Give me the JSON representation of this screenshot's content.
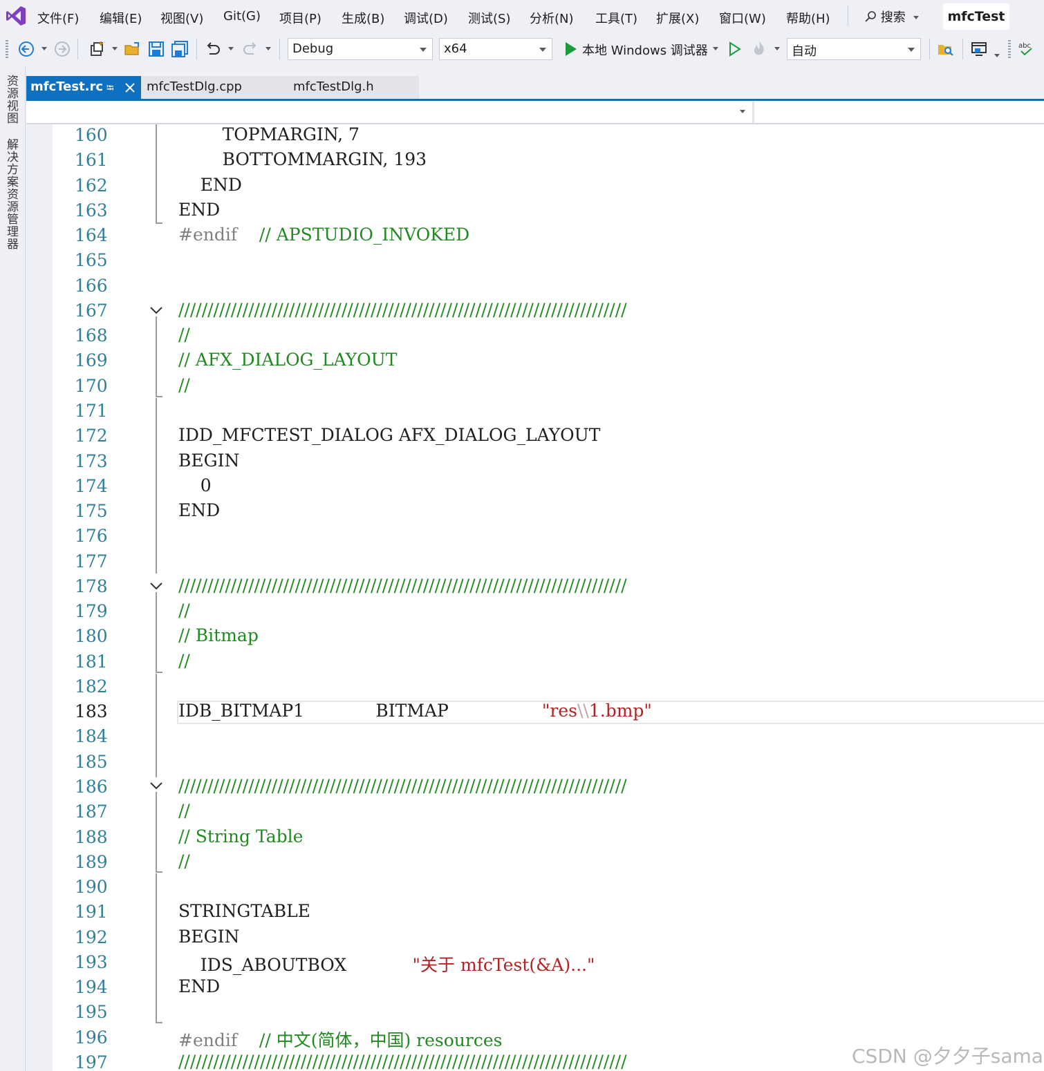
{
  "menubar": {
    "items": [
      "文件(F)",
      "编辑(E)",
      "视图(V)",
      "Git(G)",
      "项目(P)",
      "生成(B)",
      "调试(D)",
      "测试(S)",
      "分析(N)",
      "工具(T)",
      "扩展(X)",
      "窗口(W)",
      "帮助(H)"
    ],
    "search_label": "搜索",
    "solution_title": "mfcTest"
  },
  "toolbar": {
    "config_value": "Debug",
    "platform_value": "x64",
    "run_label": "本地 Windows 调试器",
    "auto_value": "自动"
  },
  "sidepanel": {
    "tabs": [
      "资源视图",
      "解决方案资源管理器"
    ]
  },
  "tabs": [
    {
      "label": "mfcTest.rc",
      "active": true
    },
    {
      "label": "mfcTestDlg.cpp",
      "active": false
    },
    {
      "label": "mfcTestDlg.h",
      "active": false
    }
  ],
  "editor": {
    "current_line": 183,
    "lines": [
      {
        "n": "160",
        "text": "        TOPMARGIN, 7",
        "kind": "plain"
      },
      {
        "n": "161",
        "text": "        BOTTOMMARGIN, 193",
        "kind": "plain"
      },
      {
        "n": "162",
        "text": "    END",
        "kind": "plain"
      },
      {
        "n": "163",
        "text": "END",
        "kind": "plain"
      },
      {
        "n": "164",
        "text": "#endif",
        "kind": "pp",
        "extra": "    // APSTUDIO_INVOKED"
      },
      {
        "n": "165",
        "text": "",
        "kind": "plain"
      },
      {
        "n": "166",
        "text": "",
        "kind": "plain"
      },
      {
        "n": "167",
        "text": "/////////////////////////////////////////////////////////////////////////////",
        "kind": "cm"
      },
      {
        "n": "168",
        "text": "//",
        "kind": "cm"
      },
      {
        "n": "169",
        "text": "// AFX_DIALOG_LAYOUT",
        "kind": "cm"
      },
      {
        "n": "170",
        "text": "//",
        "kind": "cm"
      },
      {
        "n": "171",
        "text": "",
        "kind": "plain"
      },
      {
        "n": "172",
        "text": "IDD_MFCTEST_DIALOG AFX_DIALOG_LAYOUT",
        "kind": "plain"
      },
      {
        "n": "173",
        "text": "BEGIN",
        "kind": "plain"
      },
      {
        "n": "174",
        "text": "    0",
        "kind": "plain"
      },
      {
        "n": "175",
        "text": "END",
        "kind": "plain"
      },
      {
        "n": "176",
        "text": "",
        "kind": "plain"
      },
      {
        "n": "177",
        "text": "",
        "kind": "plain"
      },
      {
        "n": "178",
        "text": "/////////////////////////////////////////////////////////////////////////////",
        "kind": "cm"
      },
      {
        "n": "179",
        "text": "//",
        "kind": "cm"
      },
      {
        "n": "180",
        "text": "// Bitmap",
        "kind": "cm"
      },
      {
        "n": "181",
        "text": "//",
        "kind": "cm"
      },
      {
        "n": "182",
        "text": "",
        "kind": "plain"
      },
      {
        "n": "183",
        "text": "IDB_BITMAP1             BITMAP                 ",
        "kind": "plain",
        "str_a": "\"res",
        "str_esc": "\\\\",
        "str_b": "1.bmp\""
      },
      {
        "n": "184",
        "text": "",
        "kind": "plain"
      },
      {
        "n": "185",
        "text": "",
        "kind": "plain"
      },
      {
        "n": "186",
        "text": "/////////////////////////////////////////////////////////////////////////////",
        "kind": "cm"
      },
      {
        "n": "187",
        "text": "//",
        "kind": "cm"
      },
      {
        "n": "188",
        "text": "// String Table",
        "kind": "cm"
      },
      {
        "n": "189",
        "text": "//",
        "kind": "cm"
      },
      {
        "n": "190",
        "text": "",
        "kind": "plain"
      },
      {
        "n": "191",
        "text": "STRINGTABLE",
        "kind": "plain"
      },
      {
        "n": "192",
        "text": "BEGIN",
        "kind": "plain"
      },
      {
        "n": "193",
        "text": "    IDS_ABOUTBOX            ",
        "kind": "plain",
        "str": "\"关于 mfcTest(&A)...\""
      },
      {
        "n": "194",
        "text": "END",
        "kind": "plain"
      },
      {
        "n": "195",
        "text": "",
        "kind": "plain"
      },
      {
        "n": "196",
        "text": "#endif",
        "kind": "pp",
        "extra": "    // 中文(简体，中国) resources"
      },
      {
        "n": "197",
        "text": "/////////////////////////////////////////////////////////////////////////////",
        "kind": "cm"
      }
    ]
  },
  "watermark": "CSDN @夕夕子sama",
  "colors": {
    "accent": "#0e70c0",
    "comment": "#1f8a1f",
    "string": "#b22222",
    "preprocessor": "#808080",
    "line_number": "#2f7f9a"
  }
}
